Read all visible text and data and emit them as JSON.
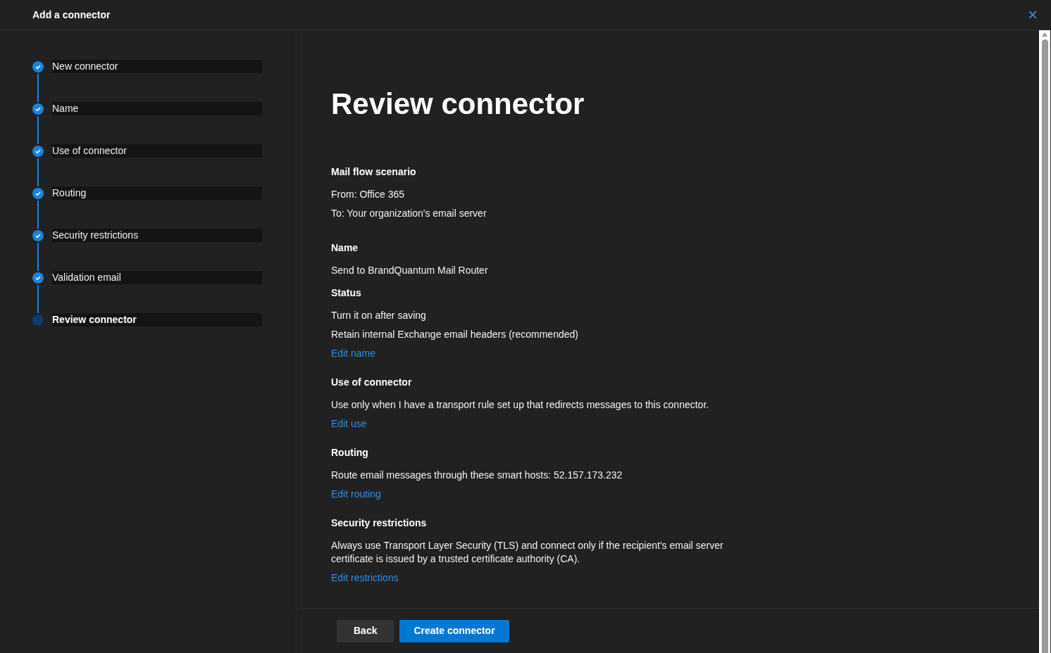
{
  "window": {
    "title": "Add a connector",
    "close": "×"
  },
  "steps": [
    {
      "label": "New connector",
      "completed": true,
      "selected": false
    },
    {
      "label": "Name",
      "completed": true,
      "selected": false
    },
    {
      "label": "Use of connector",
      "completed": true,
      "selected": false
    },
    {
      "label": "Routing",
      "completed": true,
      "selected": false
    },
    {
      "label": "Security restrictions",
      "completed": true,
      "selected": false
    },
    {
      "label": "Validation email",
      "completed": true,
      "selected": false
    },
    {
      "label": "Review connector",
      "completed": false,
      "selected": true
    }
  ],
  "page_title": "Review connector",
  "sections": [
    {
      "items": [
        {
          "kind": "heading",
          "text": "Mail flow scenario"
        },
        {
          "kind": "text",
          "text": "From: Office 365"
        },
        {
          "kind": "text",
          "text": "To: Your organization's email server"
        }
      ]
    },
    {
      "items": [
        {
          "kind": "heading",
          "text": "Name"
        },
        {
          "kind": "text",
          "text": "Send to BrandQuantum Mail Router"
        },
        {
          "kind": "heading",
          "text": "Status"
        },
        {
          "kind": "text",
          "text": "Turn it on after saving"
        },
        {
          "kind": "text",
          "text": "Retain internal Exchange email headers (recommended)"
        },
        {
          "kind": "link",
          "text": "Edit name"
        }
      ]
    },
    {
      "items": [
        {
          "kind": "heading",
          "text": "Use of connector"
        },
        {
          "kind": "text",
          "text": "Use only when I have a transport rule set up that redirects messages to this connector."
        },
        {
          "kind": "link",
          "text": "Edit use"
        }
      ]
    },
    {
      "items": [
        {
          "kind": "heading",
          "text": "Routing"
        },
        {
          "kind": "text",
          "text": "Route email messages through these smart hosts: 52.157.173.232"
        },
        {
          "kind": "link",
          "text": "Edit routing"
        }
      ]
    },
    {
      "items": [
        {
          "kind": "heading",
          "text": "Security restrictions"
        },
        {
          "kind": "text",
          "text": "Always use Transport Layer Security (TLS) and connect only if the recipient's email server certificate is issued by a trusted certificate authority (CA)."
        },
        {
          "kind": "link",
          "text": "Edit restrictions"
        }
      ]
    }
  ],
  "buttons": [
    {
      "label": "Back",
      "kind": "secondary"
    },
    {
      "label": "Create connector",
      "kind": "primary"
    }
  ]
}
